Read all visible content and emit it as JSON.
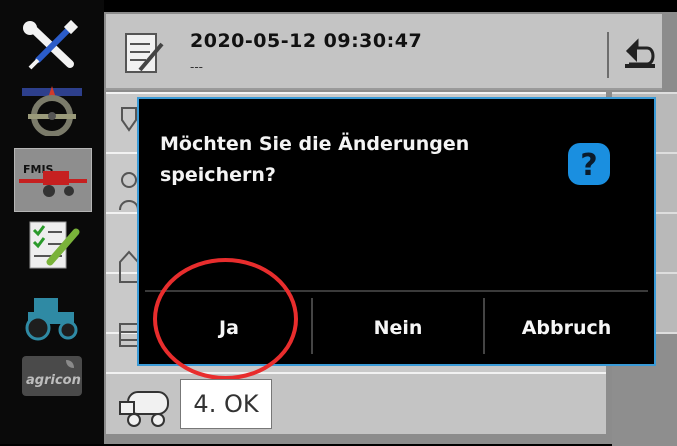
{
  "header": {
    "title": "2020-05-12 09:30:47",
    "subtitle": "---"
  },
  "dialog": {
    "message": "Möchten Sie die Änderungen speichern?",
    "buttons": {
      "yes": "Ja",
      "no": "Nein",
      "cancel": "Abbruch"
    }
  },
  "annotation": {
    "step_label": "4. OK"
  },
  "sidebar": {
    "icons": [
      "tools-icon",
      "steering-wheel-icon",
      "fmis-sprayer-icon",
      "task-checklist-icon",
      "tractor-icon",
      "agricon-logo"
    ]
  },
  "colors": {
    "dialog_border": "#3a9ad6",
    "annotation_circle": "#e82d2d",
    "help_icon": "#1a8fe0"
  }
}
